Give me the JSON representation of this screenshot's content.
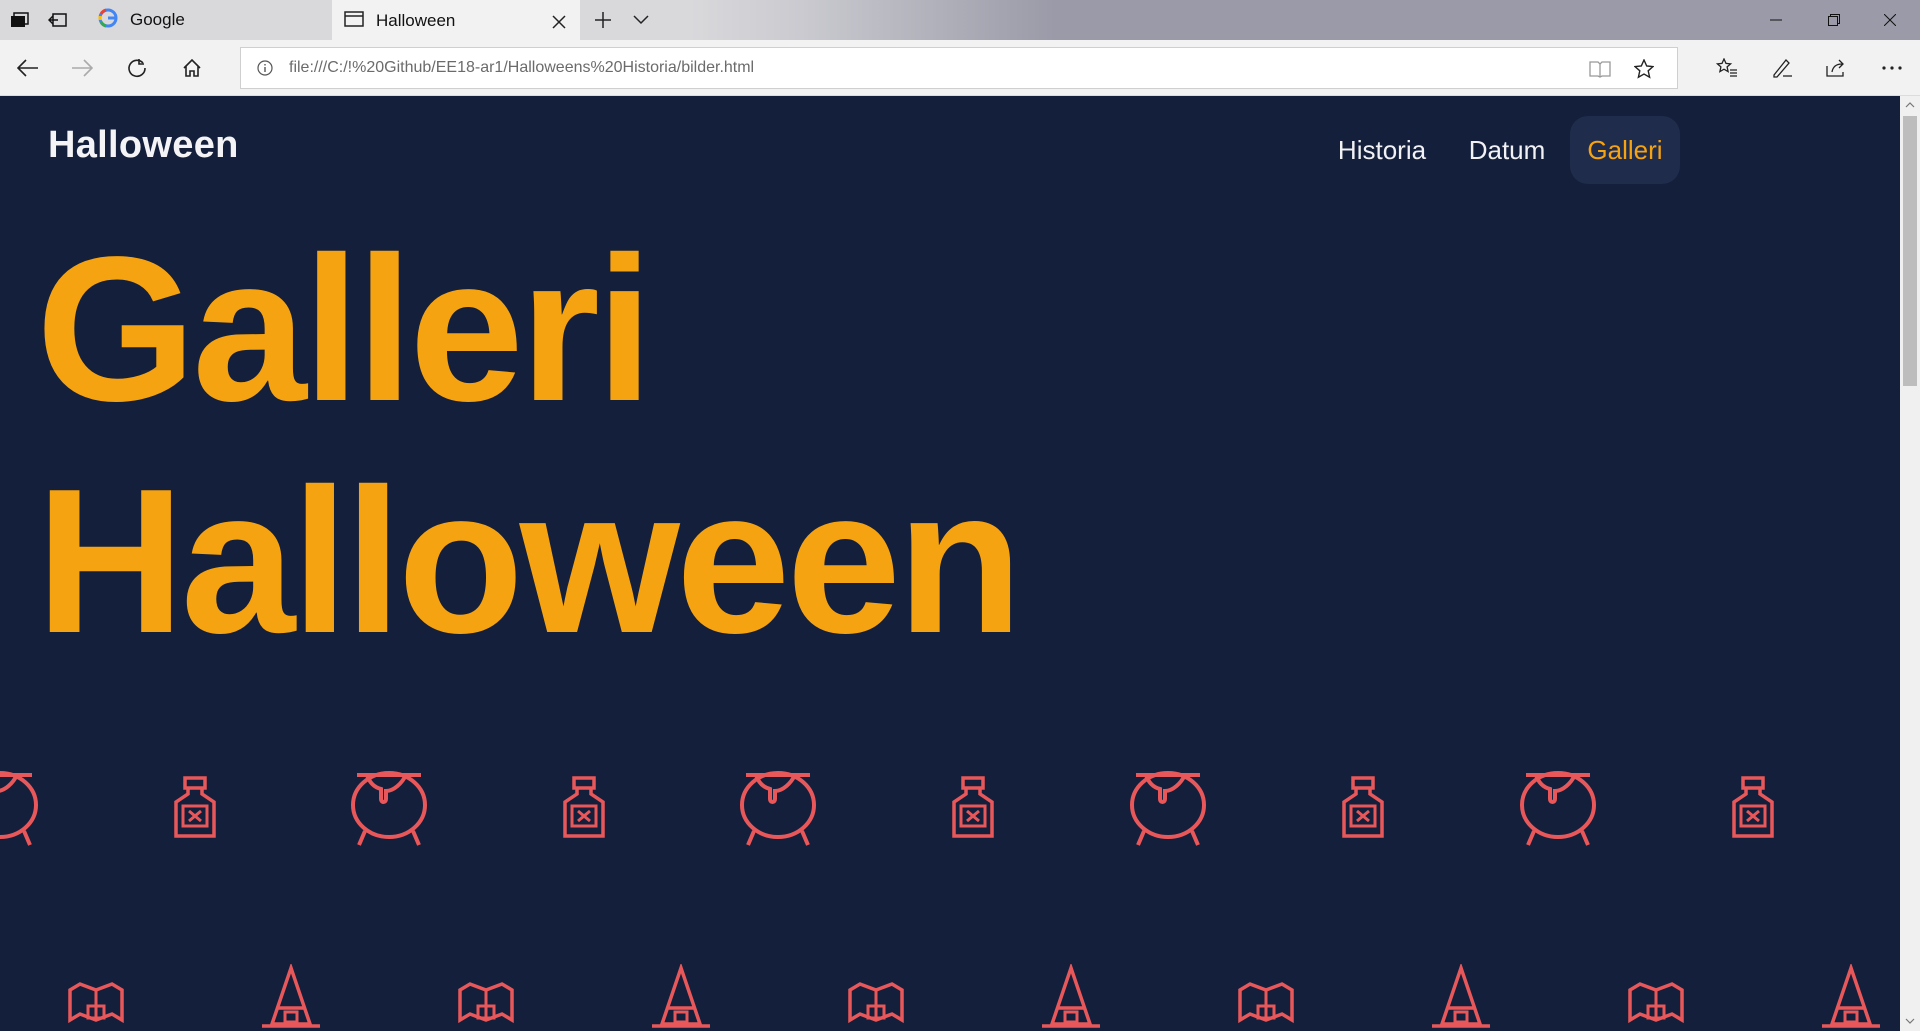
{
  "browser": {
    "tabs": [
      {
        "label": "Google",
        "icon": "google-icon"
      },
      {
        "label": "Halloween",
        "icon": "page-icon"
      }
    ],
    "address": "file:///C:/!%20Github/EE18-ar1/Halloweens%20Historia/bilder.html"
  },
  "site": {
    "brand": "Halloween",
    "nav": [
      {
        "label": "Historia"
      },
      {
        "label": "Datum"
      },
      {
        "label": "Galleri",
        "active": true
      }
    ],
    "hero_line1": "Galleri",
    "hero_line2": "Halloween"
  },
  "colors": {
    "background": "#141f3b",
    "accent": "#f6a312",
    "icon": "#e8585a",
    "nav_active_bg": "#202c4c"
  },
  "pattern_icons": [
    "cauldron-icon",
    "poison-bottle-icon",
    "bat-icon",
    "witch-hat-icon"
  ]
}
